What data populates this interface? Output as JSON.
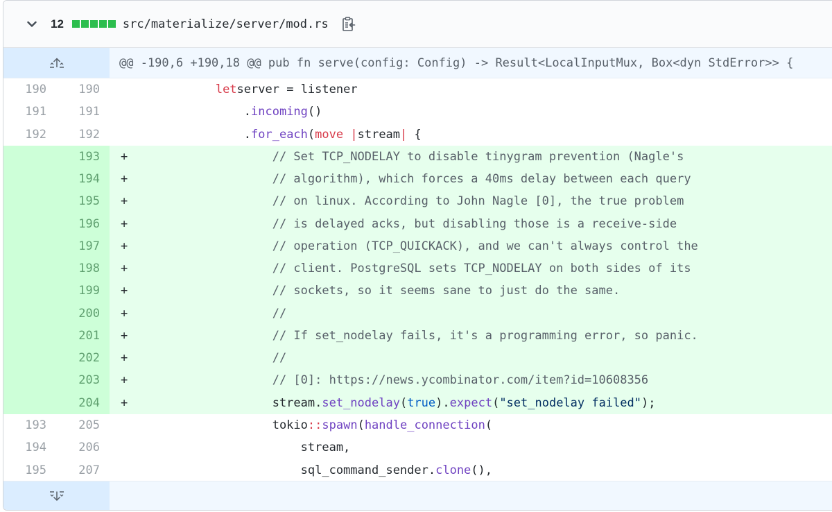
{
  "file": {
    "additions": "12",
    "path": "src/materialize/server/mod.rs",
    "diffstat_blocks": 5,
    "colors": {
      "added": "#2cbe4e",
      "add_bg": "#e6ffed",
      "add_num_bg": "#cdffd8",
      "hunk_bg": "#f1f8ff",
      "expander_bg": "#dbedff"
    }
  },
  "hunk": {
    "header": "@@ -190,6 +190,18 @@ pub fn serve(config: Config) -> Result<LocalInputMux, Box<dyn StdError>> {"
  },
  "rows": [
    {
      "old": "190",
      "new": "190",
      "sign": "",
      "type": "ctx",
      "indent": "            ",
      "tokens": [
        [
          "kw",
          "let"
        ],
        [
          "",
          "server"
        ],
        [
          "",
          " = "
        ],
        [
          "",
          "listener"
        ]
      ]
    },
    {
      "old": "191",
      "new": "191",
      "sign": "",
      "type": "ctx",
      "indent": "                ",
      "tokens": [
        [
          "",
          "."
        ],
        [
          "fn",
          "incoming"
        ],
        [
          "",
          "()"
        ]
      ]
    },
    {
      "old": "192",
      "new": "192",
      "sign": "",
      "type": "ctx",
      "indent": "                ",
      "tokens": [
        [
          "",
          "."
        ],
        [
          "fn",
          "for_each"
        ],
        [
          "",
          "("
        ],
        [
          "kw",
          "move"
        ],
        [
          "",
          " "
        ],
        [
          "kw",
          "|"
        ],
        [
          "",
          "stream"
        ],
        [
          "kw",
          "|"
        ],
        [
          "",
          " {"
        ]
      ]
    },
    {
      "old": "",
      "new": "193",
      "sign": "+",
      "type": "add",
      "indent": "                    ",
      "tokens": [
        [
          "cm",
          "// Set TCP_NODELAY to disable tinygram prevention (Nagle's"
        ]
      ]
    },
    {
      "old": "",
      "new": "194",
      "sign": "+",
      "type": "add",
      "indent": "                    ",
      "tokens": [
        [
          "cm",
          "// algorithm), which forces a 40ms delay between each query"
        ]
      ]
    },
    {
      "old": "",
      "new": "195",
      "sign": "+",
      "type": "add",
      "indent": "                    ",
      "tokens": [
        [
          "cm",
          "// on linux. According to John Nagle [0], the true problem"
        ]
      ]
    },
    {
      "old": "",
      "new": "196",
      "sign": "+",
      "type": "add",
      "indent": "                    ",
      "tokens": [
        [
          "cm",
          "// is delayed acks, but disabling those is a receive-side"
        ]
      ]
    },
    {
      "old": "",
      "new": "197",
      "sign": "+",
      "type": "add",
      "indent": "                    ",
      "tokens": [
        [
          "cm",
          "// operation (TCP_QUICKACK), and we can't always control the"
        ]
      ]
    },
    {
      "old": "",
      "new": "198",
      "sign": "+",
      "type": "add",
      "indent": "                    ",
      "tokens": [
        [
          "cm",
          "// client. PostgreSQL sets TCP_NODELAY on both sides of its"
        ]
      ]
    },
    {
      "old": "",
      "new": "199",
      "sign": "+",
      "type": "add",
      "indent": "                    ",
      "tokens": [
        [
          "cm",
          "// sockets, so it seems sane to just do the same."
        ]
      ]
    },
    {
      "old": "",
      "new": "200",
      "sign": "+",
      "type": "add",
      "indent": "                    ",
      "tokens": [
        [
          "cm",
          "//"
        ]
      ]
    },
    {
      "old": "",
      "new": "201",
      "sign": "+",
      "type": "add",
      "indent": "                    ",
      "tokens": [
        [
          "cm",
          "// If set_nodelay fails, it's a programming error, so panic."
        ]
      ]
    },
    {
      "old": "",
      "new": "202",
      "sign": "+",
      "type": "add",
      "indent": "                    ",
      "tokens": [
        [
          "cm",
          "//"
        ]
      ]
    },
    {
      "old": "",
      "new": "203",
      "sign": "+",
      "type": "add",
      "indent": "                    ",
      "tokens": [
        [
          "cm",
          "// [0]: https://news.ycombinator.com/item?id=10608356"
        ]
      ]
    },
    {
      "old": "",
      "new": "204",
      "sign": "+",
      "type": "add",
      "indent": "                    ",
      "tokens": [
        [
          "",
          "stream."
        ],
        [
          "fn",
          "set_nodelay"
        ],
        [
          "",
          "("
        ],
        [
          "bool",
          "true"
        ],
        [
          "",
          ")."
        ],
        [
          "fn",
          "expect"
        ],
        [
          "",
          "("
        ],
        [
          "str",
          "\"set_nodelay failed\""
        ],
        [
          "",
          ");"
        ]
      ]
    },
    {
      "old": "193",
      "new": "205",
      "sign": "",
      "type": "ctx",
      "indent": "                    ",
      "tokens": [
        [
          "",
          "tokio"
        ],
        [
          "ns",
          "::"
        ],
        [
          "fn",
          "spawn"
        ],
        [
          "",
          "("
        ],
        [
          "fn",
          "handle_connection"
        ],
        [
          "",
          "("
        ]
      ]
    },
    {
      "old": "194",
      "new": "206",
      "sign": "",
      "type": "ctx",
      "indent": "                        ",
      "tokens": [
        [
          "",
          "stream,"
        ]
      ]
    },
    {
      "old": "195",
      "new": "207",
      "sign": "",
      "type": "ctx",
      "indent": "                        ",
      "tokens": [
        [
          "",
          "sql_command_sender."
        ],
        [
          "fn",
          "clone"
        ],
        [
          "",
          "(),"
        ]
      ]
    }
  ]
}
